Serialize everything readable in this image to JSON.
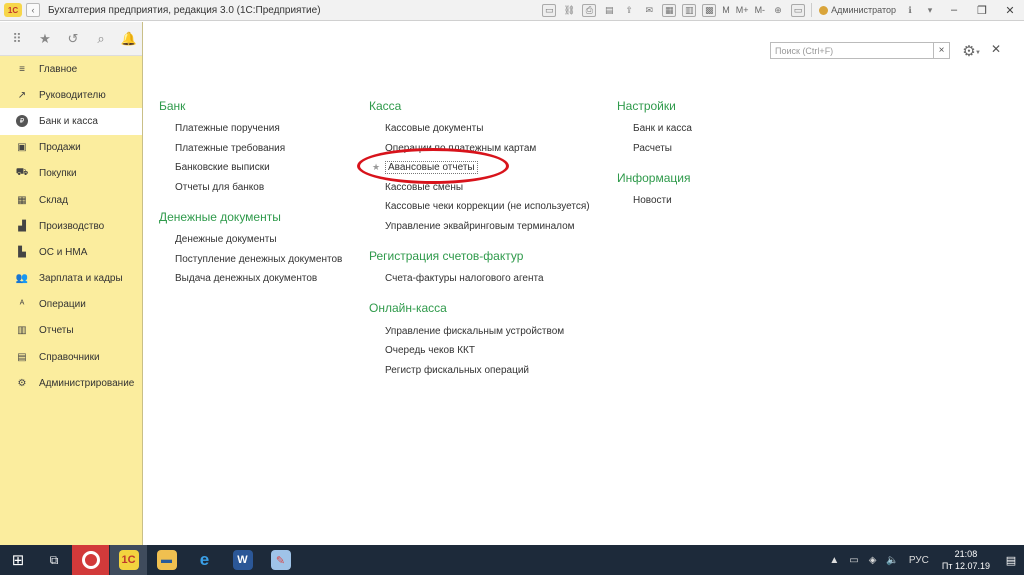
{
  "window": {
    "logo_text": "1С",
    "title": "Бухгалтерия предприятия, редакция 3.0  (1С:Предприятие)",
    "mem_buttons": [
      "M",
      "M+",
      "M-"
    ],
    "user": "Администратор"
  },
  "sidebar": {
    "items": [
      {
        "label": "Главное",
        "icon": "menu-lines-icon",
        "glyph": "≡"
      },
      {
        "label": "Руководителю",
        "icon": "trend-icon",
        "glyph": "↗"
      },
      {
        "label": "Банк и касса",
        "icon": "coin-icon",
        "glyph": "₽",
        "active": true
      },
      {
        "label": "Продажи",
        "icon": "bag-icon",
        "glyph": "▣"
      },
      {
        "label": "Покупки",
        "icon": "cart-icon",
        "glyph": "⛟"
      },
      {
        "label": "Склад",
        "icon": "boxes-icon",
        "glyph": "▦"
      },
      {
        "label": "Производство",
        "icon": "factory-icon",
        "glyph": "▟"
      },
      {
        "label": "ОС и НМА",
        "icon": "chart-bars-icon",
        "glyph": "▙"
      },
      {
        "label": "Зарплата и кадры",
        "icon": "people-icon",
        "glyph": "👥"
      },
      {
        "label": "Операции",
        "icon": "dt-kt-icon",
        "glyph": "ᴬ"
      },
      {
        "label": "Отчеты",
        "icon": "report-icon",
        "glyph": "▥"
      },
      {
        "label": "Справочники",
        "icon": "books-icon",
        "glyph": "▤"
      },
      {
        "label": "Администрирование",
        "icon": "gear-icon",
        "glyph": "⚙"
      }
    ]
  },
  "search": {
    "placeholder": "Поиск (Ctrl+F)",
    "clear": "×"
  },
  "columns": [
    {
      "sections": [
        {
          "title": "Банк",
          "links": [
            "Платежные поручения",
            "Платежные требования",
            "Банковские выписки",
            "Отчеты для банков"
          ]
        },
        {
          "title": "Денежные документы",
          "links": [
            "Денежные документы",
            "Поступление денежных документов",
            "Выдача денежных документов"
          ]
        }
      ]
    },
    {
      "sections": [
        {
          "title": "Касса",
          "links": [
            "Кассовые документы",
            "Операции по платежным картам",
            "Авансовые отчеты",
            "Кассовые смены",
            "Кассовые чеки коррекции (не используется)",
            "Управление эквайринговым терминалом"
          ]
        },
        {
          "title": "Регистрация счетов-фактур",
          "links": [
            "Счета-фактуры налогового агента"
          ]
        },
        {
          "title": "Онлайн-касса",
          "links": [
            "Управление фискальным устройством",
            "Очередь чеков ККТ",
            "Регистр фискальных операций"
          ]
        }
      ]
    },
    {
      "sections": [
        {
          "title": "Настройки",
          "links": [
            "Банк и касса",
            "Расчеты"
          ]
        },
        {
          "title": "Информация",
          "links": [
            "Новости"
          ]
        }
      ]
    }
  ],
  "taskbar": {
    "lang": "РУС",
    "time": "21:08",
    "date": "Пт 12.07.19",
    "apps": [
      "opera",
      "1c",
      "explorer",
      "ie",
      "word",
      "paint"
    ]
  }
}
